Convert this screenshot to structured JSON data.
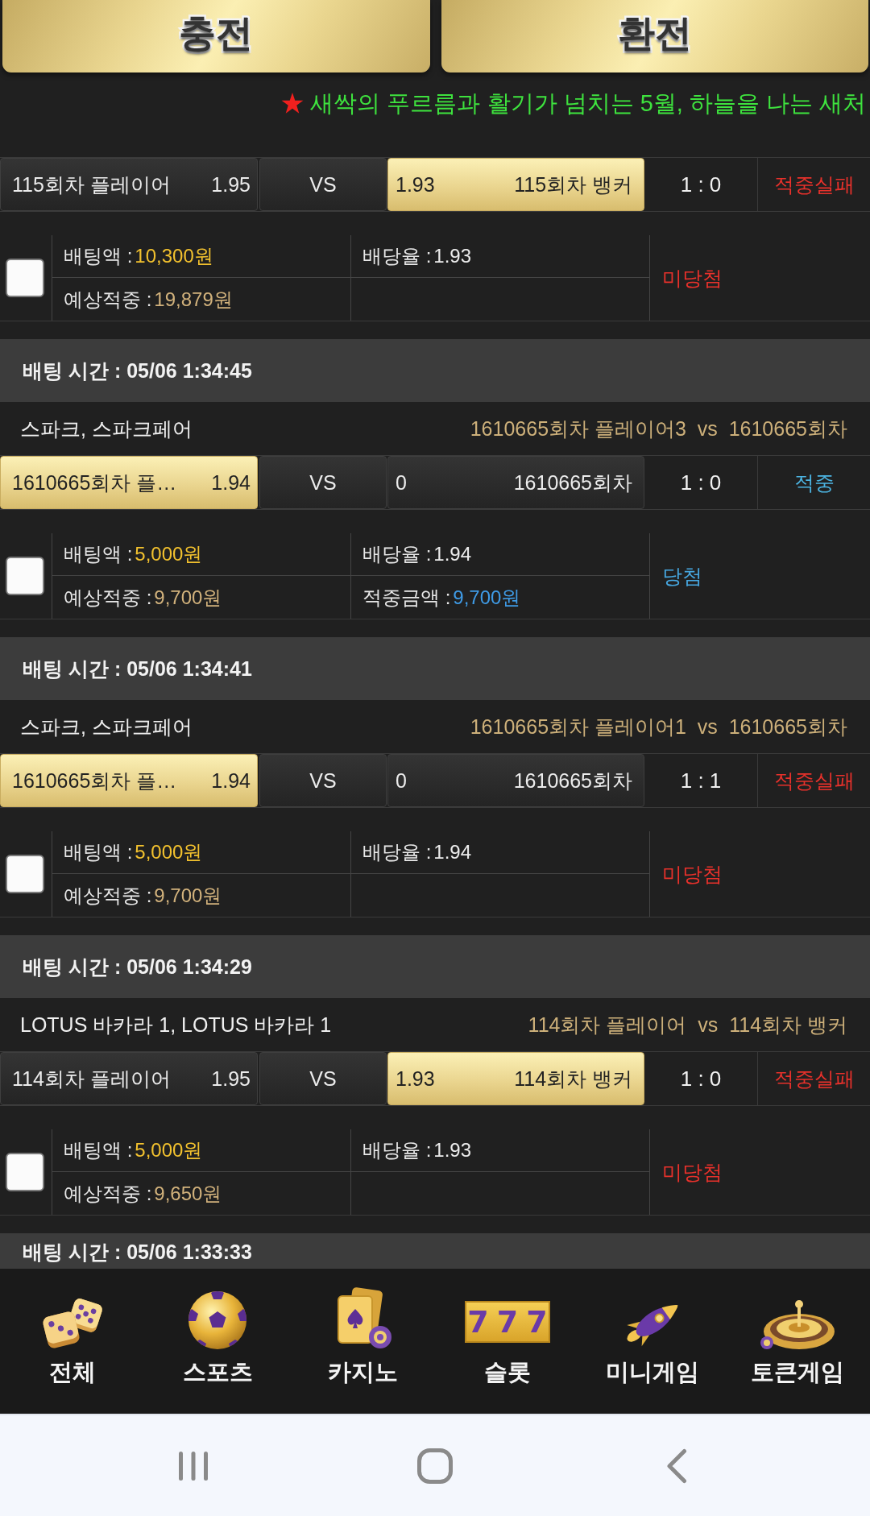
{
  "top_buttons": [
    {
      "label": "충전"
    },
    {
      "label": "환전"
    }
  ],
  "notice": {
    "text": "새싹의 푸르름과 활기가 넘치는 5월, 하늘을 나는 새처"
  },
  "bets": [
    {
      "home": {
        "name": "115회차 플레이어",
        "odds": "1.95",
        "selected": false
      },
      "vs": "VS",
      "away": {
        "odds": "1.93",
        "name": "115회차 뱅커",
        "selected": true
      },
      "score": "1 : 0",
      "result": "적중실패",
      "won": false,
      "checked": false,
      "details": [
        {
          "kind": "stake",
          "label": "배팅액 :",
          "value": "10,300원"
        },
        {
          "kind": "odds",
          "label": "배당율 :",
          "value": "1.93"
        },
        {
          "kind": "expected",
          "label": "예상적중 :",
          "value": "19,879원"
        }
      ],
      "status": "미당첨"
    },
    {
      "time": "배팅 시간 : 05/06 1:34:45",
      "game": "스파크, 스파크페어",
      "matchup": "1610665회차 플레이어3  vs  1610665회차",
      "home": {
        "name": "1610665회차 플…",
        "odds": "1.94",
        "selected": true
      },
      "vs": "VS",
      "away": {
        "odds": "0",
        "name": "1610665회차",
        "selected": false
      },
      "score": "1 : 0",
      "result": "적중",
      "won": true,
      "checked": false,
      "details": [
        {
          "kind": "stake",
          "label": "배팅액 :",
          "value": "5,000원"
        },
        {
          "kind": "odds",
          "label": "배당율 :",
          "value": "1.94"
        },
        {
          "kind": "expected",
          "label": "예상적중 :",
          "value": "9,700원"
        },
        {
          "kind": "payout",
          "label": "적중금액 :",
          "value": "9,700원"
        }
      ],
      "status": "당첨"
    },
    {
      "time": "배팅 시간 : 05/06 1:34:41",
      "game": "스파크, 스파크페어",
      "matchup": "1610665회차 플레이어1  vs  1610665회차",
      "home": {
        "name": "1610665회차 플…",
        "odds": "1.94",
        "selected": true
      },
      "vs": "VS",
      "away": {
        "odds": "0",
        "name": "1610665회차",
        "selected": false
      },
      "score": "1 : 1",
      "result": "적중실패",
      "won": false,
      "checked": false,
      "details": [
        {
          "kind": "stake",
          "label": "배팅액 :",
          "value": "5,000원"
        },
        {
          "kind": "odds",
          "label": "배당율 :",
          "value": "1.94"
        },
        {
          "kind": "expected",
          "label": "예상적중 :",
          "value": "9,700원"
        }
      ],
      "status": "미당첨"
    },
    {
      "time": "배팅 시간 : 05/06 1:34:29",
      "game": "LOTUS 바카라 1, LOTUS 바카라 1",
      "matchup": "114회차 플레이어  vs  114회차 뱅커",
      "home": {
        "name": "114회차 플레이어",
        "odds": "1.95",
        "selected": false
      },
      "vs": "VS",
      "away": {
        "odds": "1.93",
        "name": "114회차 뱅커",
        "selected": true
      },
      "score": "1 : 0",
      "result": "적중실패",
      "won": false,
      "checked": false,
      "details": [
        {
          "kind": "stake",
          "label": "배팅액 :",
          "value": "5,000원"
        },
        {
          "kind": "odds",
          "label": "배당율 :",
          "value": "1.93"
        },
        {
          "kind": "expected",
          "label": "예상적중 :",
          "value": "9,650원"
        }
      ],
      "status": "미당첨"
    },
    {
      "time": "배팅 시간 : 05/06 1:33:33"
    }
  ],
  "bottom_nav": [
    {
      "label": "전체"
    },
    {
      "label": "스포츠"
    },
    {
      "label": "카지노"
    },
    {
      "label": "슬롯",
      "reels": "777"
    },
    {
      "label": "미니게임"
    },
    {
      "label": "토큰게임"
    }
  ]
}
